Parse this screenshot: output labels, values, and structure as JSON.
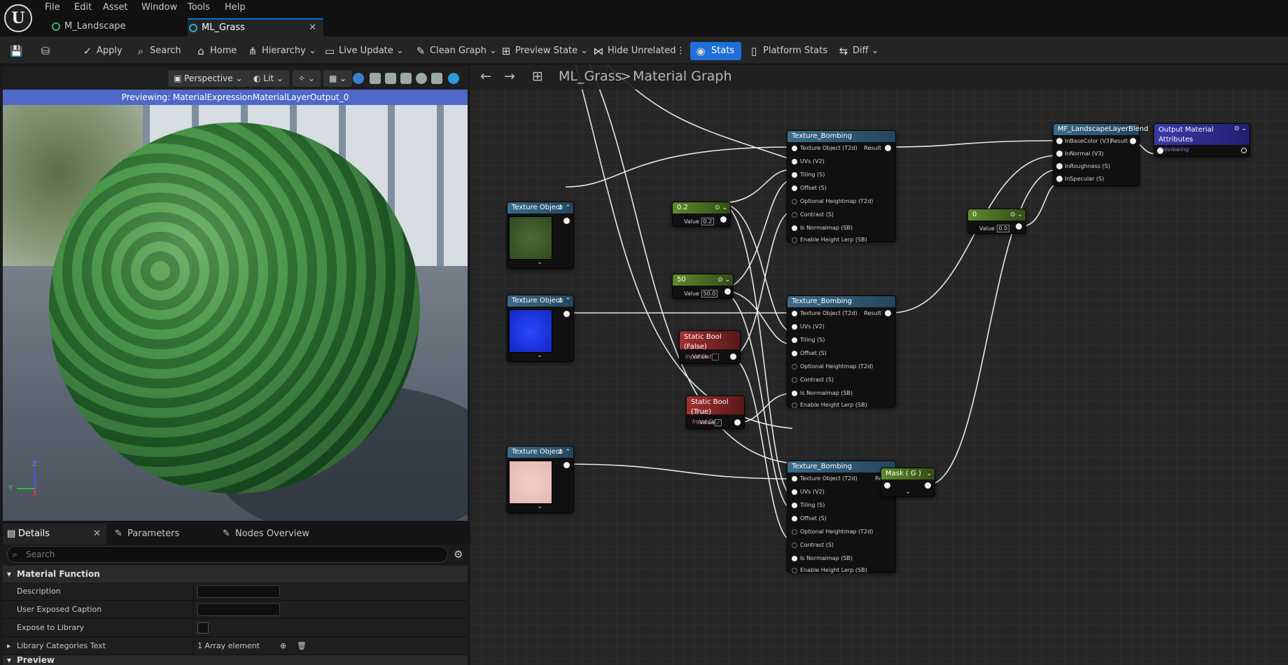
{
  "menu": [
    "File",
    "Edit",
    "Asset",
    "Window",
    "Tools",
    "Help"
  ],
  "tabs": [
    {
      "label": "M_Landscape"
    },
    {
      "label": "ML_Grass",
      "close": "✕"
    }
  ],
  "toolbar": {
    "apply": "Apply",
    "search": "Search",
    "home": "Home",
    "hierarchy": "Hierarchy",
    "live_update": "Live Update",
    "clean_graph": "Clean Graph",
    "preview_state": "Preview State",
    "hide_unrelated": "Hide Unrelated",
    "stats": "Stats",
    "platform_stats": "Platform Stats",
    "diff": "Diff"
  },
  "viewport": {
    "perspective": "Perspective",
    "lit": "Lit",
    "banner": "Previewing: MaterialExpressionMaterialLayerOutput_0",
    "axis_z": "Z",
    "axis_y": "Y",
    "axis_x": "X"
  },
  "details": {
    "tabs": [
      "Details",
      "Parameters",
      "Nodes Overview"
    ],
    "search_placeholder": "Search",
    "section": "Material Function",
    "rows": [
      {
        "label": "Description"
      },
      {
        "label": "User Exposed Caption"
      },
      {
        "label": "Expose to Library"
      },
      {
        "label": "Library Categories Text",
        "value": "1 Array element"
      }
    ],
    "next_section": "Preview"
  },
  "graph": {
    "breadcrumb_root": "ML_Grass",
    "breadcrumb_sep": ">",
    "breadcrumb_leaf": "Material Graph"
  },
  "nodes": {
    "tex_obj_1": {
      "title": "Texture Object"
    },
    "tex_obj_2": {
      "title": "Texture Object"
    },
    "tex_obj_3": {
      "title": "Texture Object"
    },
    "const_02": {
      "title": "0.2",
      "value_label": "Value",
      "value": "0.2"
    },
    "const_50": {
      "title": "50",
      "value_label": "Value",
      "value": "50.0"
    },
    "const_0": {
      "title": "0",
      "value_label": "Value",
      "value": "0.0"
    },
    "static_false": {
      "title": "Static Bool (False)",
      "sub": "Input Data",
      "value_label": "Value"
    },
    "static_true": {
      "title": "Static Bool (True)",
      "sub": "Input Data",
      "value_label": "Value"
    },
    "bomb": {
      "title": "Texture_Bombing",
      "result": "Result",
      "pins": [
        "Texture Object (T2d)",
        "UVs (V2)",
        "Tiling (S)",
        "Offset (S)",
        "Optional Heightmap (T2d)",
        "Contrast (S)",
        "Is Normalmap (SB)",
        "Enable Height Lerp (SB)"
      ]
    },
    "mask": {
      "title": "Mask ( G )"
    },
    "blend": {
      "title": "MF_LandscapeLayerBlend",
      "result": "Result",
      "pins": [
        "InBaseColor (V3)",
        "InNormal (V3)",
        "InRoughness (S)",
        "InSpecular (S)"
      ]
    },
    "output": {
      "title": "Output Material Attributes",
      "sub": "Previewing"
    }
  },
  "colors": {
    "accent": "#1d70d8",
    "banner": "#5068c8"
  }
}
